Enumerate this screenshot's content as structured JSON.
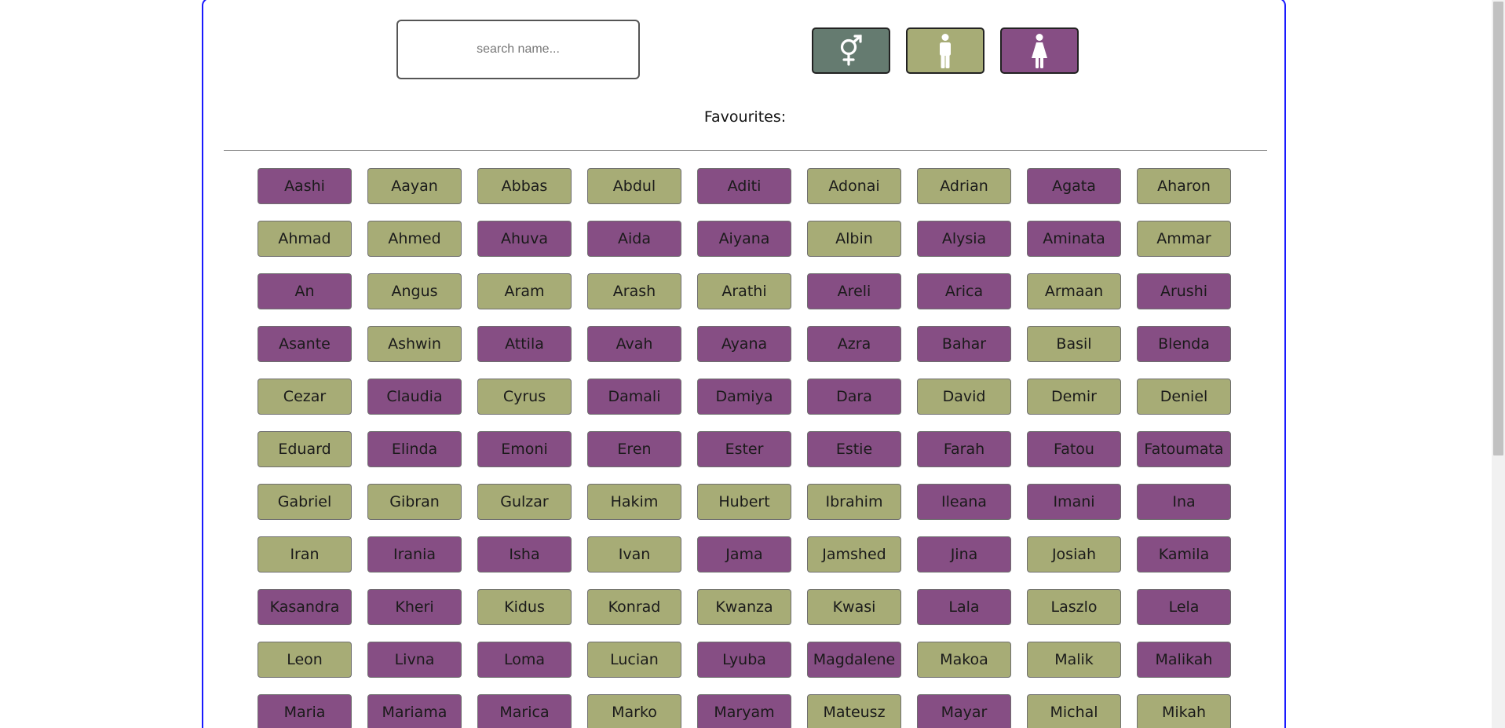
{
  "colors": {
    "all": "#657b70",
    "male": "#a7ac76",
    "female": "#864e84"
  },
  "search": {
    "placeholder": "search name...",
    "value": ""
  },
  "filters": [
    {
      "name": "filter-all-button",
      "icon": "gender-neutral-icon",
      "color": "#657b70"
    },
    {
      "name": "filter-male-button",
      "icon": "male-figure-icon",
      "color": "#a7ac76"
    },
    {
      "name": "filter-female-button",
      "icon": "female-figure-icon",
      "color": "#864e84"
    }
  ],
  "favourites": {
    "label": "Favourites:"
  },
  "names": [
    {
      "label": "Aashi",
      "gender": "female"
    },
    {
      "label": "Aayan",
      "gender": "male"
    },
    {
      "label": "Abbas",
      "gender": "male"
    },
    {
      "label": "Abdul",
      "gender": "male"
    },
    {
      "label": "Aditi",
      "gender": "female"
    },
    {
      "label": "Adonai",
      "gender": "male"
    },
    {
      "label": "Adrian",
      "gender": "male"
    },
    {
      "label": "Agata",
      "gender": "female"
    },
    {
      "label": "Aharon",
      "gender": "male"
    },
    {
      "label": "Ahmad",
      "gender": "male"
    },
    {
      "label": "Ahmed",
      "gender": "male"
    },
    {
      "label": "Ahuva",
      "gender": "female"
    },
    {
      "label": "Aida",
      "gender": "female"
    },
    {
      "label": "Aiyana",
      "gender": "female"
    },
    {
      "label": "Albin",
      "gender": "male"
    },
    {
      "label": "Alysia",
      "gender": "female"
    },
    {
      "label": "Aminata",
      "gender": "female"
    },
    {
      "label": "Ammar",
      "gender": "male"
    },
    {
      "label": "An",
      "gender": "female"
    },
    {
      "label": "Angus",
      "gender": "male"
    },
    {
      "label": "Aram",
      "gender": "male"
    },
    {
      "label": "Arash",
      "gender": "male"
    },
    {
      "label": "Arathi",
      "gender": "male"
    },
    {
      "label": "Areli",
      "gender": "female"
    },
    {
      "label": "Arica",
      "gender": "female"
    },
    {
      "label": "Armaan",
      "gender": "male"
    },
    {
      "label": "Arushi",
      "gender": "female"
    },
    {
      "label": "Asante",
      "gender": "female"
    },
    {
      "label": "Ashwin",
      "gender": "male"
    },
    {
      "label": "Attila",
      "gender": "female"
    },
    {
      "label": "Avah",
      "gender": "female"
    },
    {
      "label": "Ayana",
      "gender": "female"
    },
    {
      "label": "Azra",
      "gender": "female"
    },
    {
      "label": "Bahar",
      "gender": "female"
    },
    {
      "label": "Basil",
      "gender": "male"
    },
    {
      "label": "Blenda",
      "gender": "female"
    },
    {
      "label": "Cezar",
      "gender": "male"
    },
    {
      "label": "Claudia",
      "gender": "female"
    },
    {
      "label": "Cyrus",
      "gender": "male"
    },
    {
      "label": "Damali",
      "gender": "female"
    },
    {
      "label": "Damiya",
      "gender": "female"
    },
    {
      "label": "Dara",
      "gender": "female"
    },
    {
      "label": "David",
      "gender": "male"
    },
    {
      "label": "Demir",
      "gender": "male"
    },
    {
      "label": "Deniel",
      "gender": "male"
    },
    {
      "label": "Eduard",
      "gender": "male"
    },
    {
      "label": "Elinda",
      "gender": "female"
    },
    {
      "label": "Emoni",
      "gender": "female"
    },
    {
      "label": "Eren",
      "gender": "female"
    },
    {
      "label": "Ester",
      "gender": "female"
    },
    {
      "label": "Estie",
      "gender": "female"
    },
    {
      "label": "Farah",
      "gender": "female"
    },
    {
      "label": "Fatou",
      "gender": "female"
    },
    {
      "label": "Fatoumata",
      "gender": "female"
    },
    {
      "label": "Gabriel",
      "gender": "male"
    },
    {
      "label": "Gibran",
      "gender": "male"
    },
    {
      "label": "Gulzar",
      "gender": "male"
    },
    {
      "label": "Hakim",
      "gender": "male"
    },
    {
      "label": "Hubert",
      "gender": "male"
    },
    {
      "label": "Ibrahim",
      "gender": "male"
    },
    {
      "label": "Ileana",
      "gender": "female"
    },
    {
      "label": "Imani",
      "gender": "female"
    },
    {
      "label": "Ina",
      "gender": "female"
    },
    {
      "label": "Iran",
      "gender": "male"
    },
    {
      "label": "Irania",
      "gender": "female"
    },
    {
      "label": "Isha",
      "gender": "female"
    },
    {
      "label": "Ivan",
      "gender": "male"
    },
    {
      "label": "Jama",
      "gender": "female"
    },
    {
      "label": "Jamshed",
      "gender": "male"
    },
    {
      "label": "Jina",
      "gender": "female"
    },
    {
      "label": "Josiah",
      "gender": "male"
    },
    {
      "label": "Kamila",
      "gender": "female"
    },
    {
      "label": "Kasandra",
      "gender": "female"
    },
    {
      "label": "Kheri",
      "gender": "female"
    },
    {
      "label": "Kidus",
      "gender": "male"
    },
    {
      "label": "Konrad",
      "gender": "male"
    },
    {
      "label": "Kwanza",
      "gender": "male"
    },
    {
      "label": "Kwasi",
      "gender": "male"
    },
    {
      "label": "Lala",
      "gender": "female"
    },
    {
      "label": "Laszlo",
      "gender": "male"
    },
    {
      "label": "Lela",
      "gender": "female"
    },
    {
      "label": "Leon",
      "gender": "male"
    },
    {
      "label": "Livna",
      "gender": "female"
    },
    {
      "label": "Loma",
      "gender": "female"
    },
    {
      "label": "Lucian",
      "gender": "male"
    },
    {
      "label": "Lyuba",
      "gender": "female"
    },
    {
      "label": "Magdalene",
      "gender": "female"
    },
    {
      "label": "Makoa",
      "gender": "male"
    },
    {
      "label": "Malik",
      "gender": "male"
    },
    {
      "label": "Malikah",
      "gender": "female"
    },
    {
      "label": "Maria",
      "gender": "female"
    },
    {
      "label": "Mariama",
      "gender": "female"
    },
    {
      "label": "Marica",
      "gender": "female"
    },
    {
      "label": "Marko",
      "gender": "male"
    },
    {
      "label": "Maryam",
      "gender": "female"
    },
    {
      "label": "Mateusz",
      "gender": "male"
    },
    {
      "label": "Mayar",
      "gender": "female"
    },
    {
      "label": "Michal",
      "gender": "male"
    },
    {
      "label": "Mikah",
      "gender": "male"
    }
  ]
}
